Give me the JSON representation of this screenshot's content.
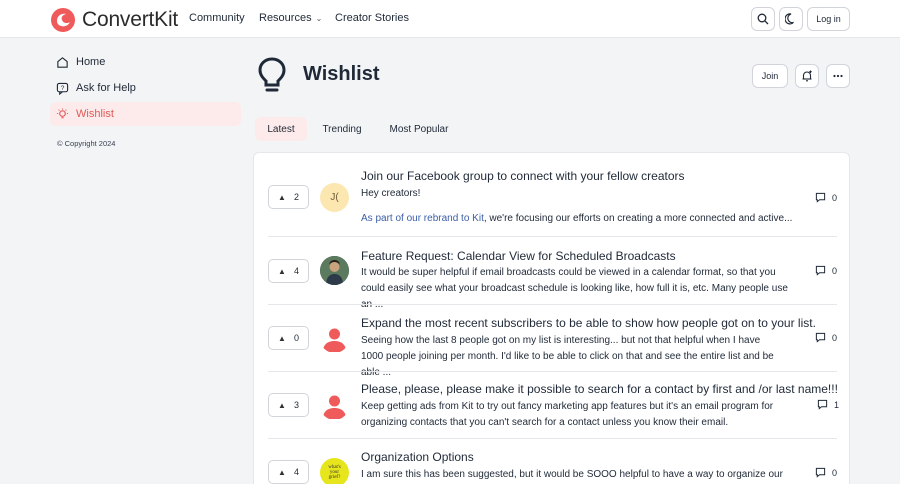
{
  "header": {
    "brand": "ConvertKit",
    "nav": {
      "community": "Community",
      "resources": "Resources",
      "creator_stories": "Creator Stories"
    },
    "login_label": "Log in"
  },
  "sidebar": {
    "items": [
      {
        "label": "Home",
        "icon": "home-icon"
      },
      {
        "label": "Ask for Help",
        "icon": "help-icon"
      },
      {
        "label": "Wishlist",
        "icon": "lightbulb-icon",
        "active": true
      }
    ],
    "copyright": "© Copyright 2024"
  },
  "page": {
    "title": "Wishlist",
    "join_label": "Join"
  },
  "tabs": [
    {
      "label": "Latest",
      "active": true
    },
    {
      "label": "Trending"
    },
    {
      "label": "Most Popular"
    }
  ],
  "posts": [
    {
      "votes": "2",
      "avatar_initials": "J(",
      "title": "Join our Facebook group to connect with your fellow creators",
      "body_line1": "Hey creators!",
      "body_link": "As part of our rebrand to Kit",
      "body_line2": ", we're focusing our efforts on creating a more connected and active...",
      "comments": "0"
    },
    {
      "votes": "4",
      "title": "Feature Request: Calendar View for Scheduled Broadcasts",
      "body": "It would be super helpful if email broadcasts could be viewed in a calendar format, so that you could easily see what your broadcast schedule is looking like, how full it is, etc. Many people use an ...",
      "comments": "0"
    },
    {
      "votes": "0",
      "title": "Expand the most recent subscribers to be able to show how people got on to your list.",
      "body": "Seeing how the last 8 people got on my list is interesting... but not that helpful when I have 1000 people joining per month. I'd like to be able to click on that and see the entire list and be able ...",
      "comments": "0"
    },
    {
      "votes": "3",
      "title": "Please, please, please make it possible to search for a contact by first and /or last name!!!",
      "body": "Keep getting ads from Kit to try out fancy marketing app features but it's an email program for organizing contacts that you can't search for a contact unless you know their email.",
      "comments": "1"
    },
    {
      "votes": "4",
      "avatar_text": "what's your grief?",
      "title": "Organization Options",
      "body": "I am sure this has been suggested, but it would be SOOO helpful to have a way to organize our",
      "comments": "0"
    }
  ],
  "colors": {
    "brand": "#ef5a5a",
    "active_bg": "#fdeaea",
    "link": "#3a5ea8"
  }
}
